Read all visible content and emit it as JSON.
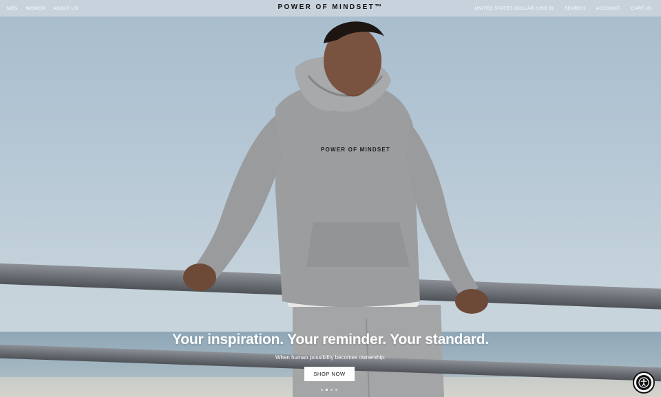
{
  "nav": {
    "left": [
      "MEN",
      "WOMEN",
      "ABOUT US"
    ],
    "brand": "POWER OF MINDSET™",
    "currency": "UNITED STATES DOLLAR (USD $)",
    "search": "SEARCH",
    "account": "ACCOUNT",
    "cart": "CART (0)"
  },
  "hero": {
    "hoodie_print": "POWER OF MINDSET",
    "headline": "Your inspiration. Your reminder. Your standard.",
    "subline": "When human possibility becomes ownership.",
    "cta": "SHOP NOW",
    "slides": 4,
    "active_slide": 1
  },
  "colors": {
    "sky": "#b4c6d4",
    "hoodie": "#9c9d9f",
    "button_bg": "#ffffff",
    "text": "#111111"
  },
  "icons": {
    "accessibility": "accessibility-icon"
  }
}
